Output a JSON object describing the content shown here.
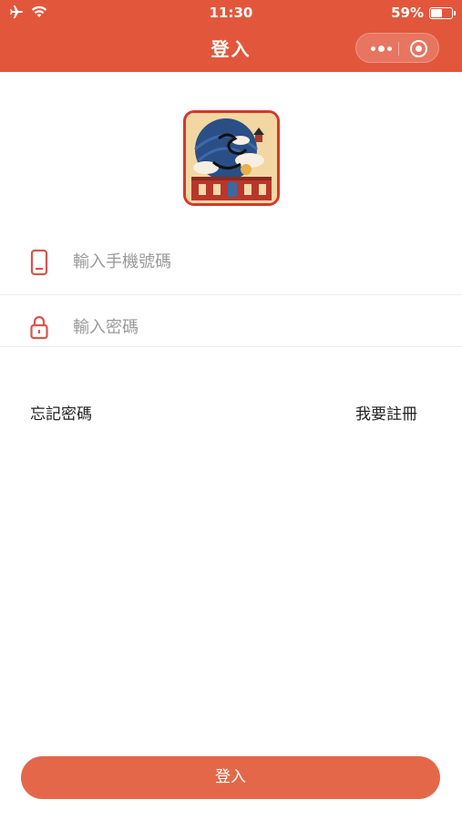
{
  "status_bar": {
    "time": "11:30",
    "battery_percent": "59%",
    "battery_level": 0.59
  },
  "nav": {
    "title": "登入"
  },
  "form": {
    "phone_placeholder": "輸入手機號碼",
    "password_placeholder": "輸入密碼"
  },
  "links": {
    "forgot_password": "忘記密碼",
    "register": "我要註冊"
  },
  "login_button": "登入",
  "colors": {
    "brand": "#e2573c",
    "button": "#e4674a",
    "icon": "#d9544b"
  }
}
